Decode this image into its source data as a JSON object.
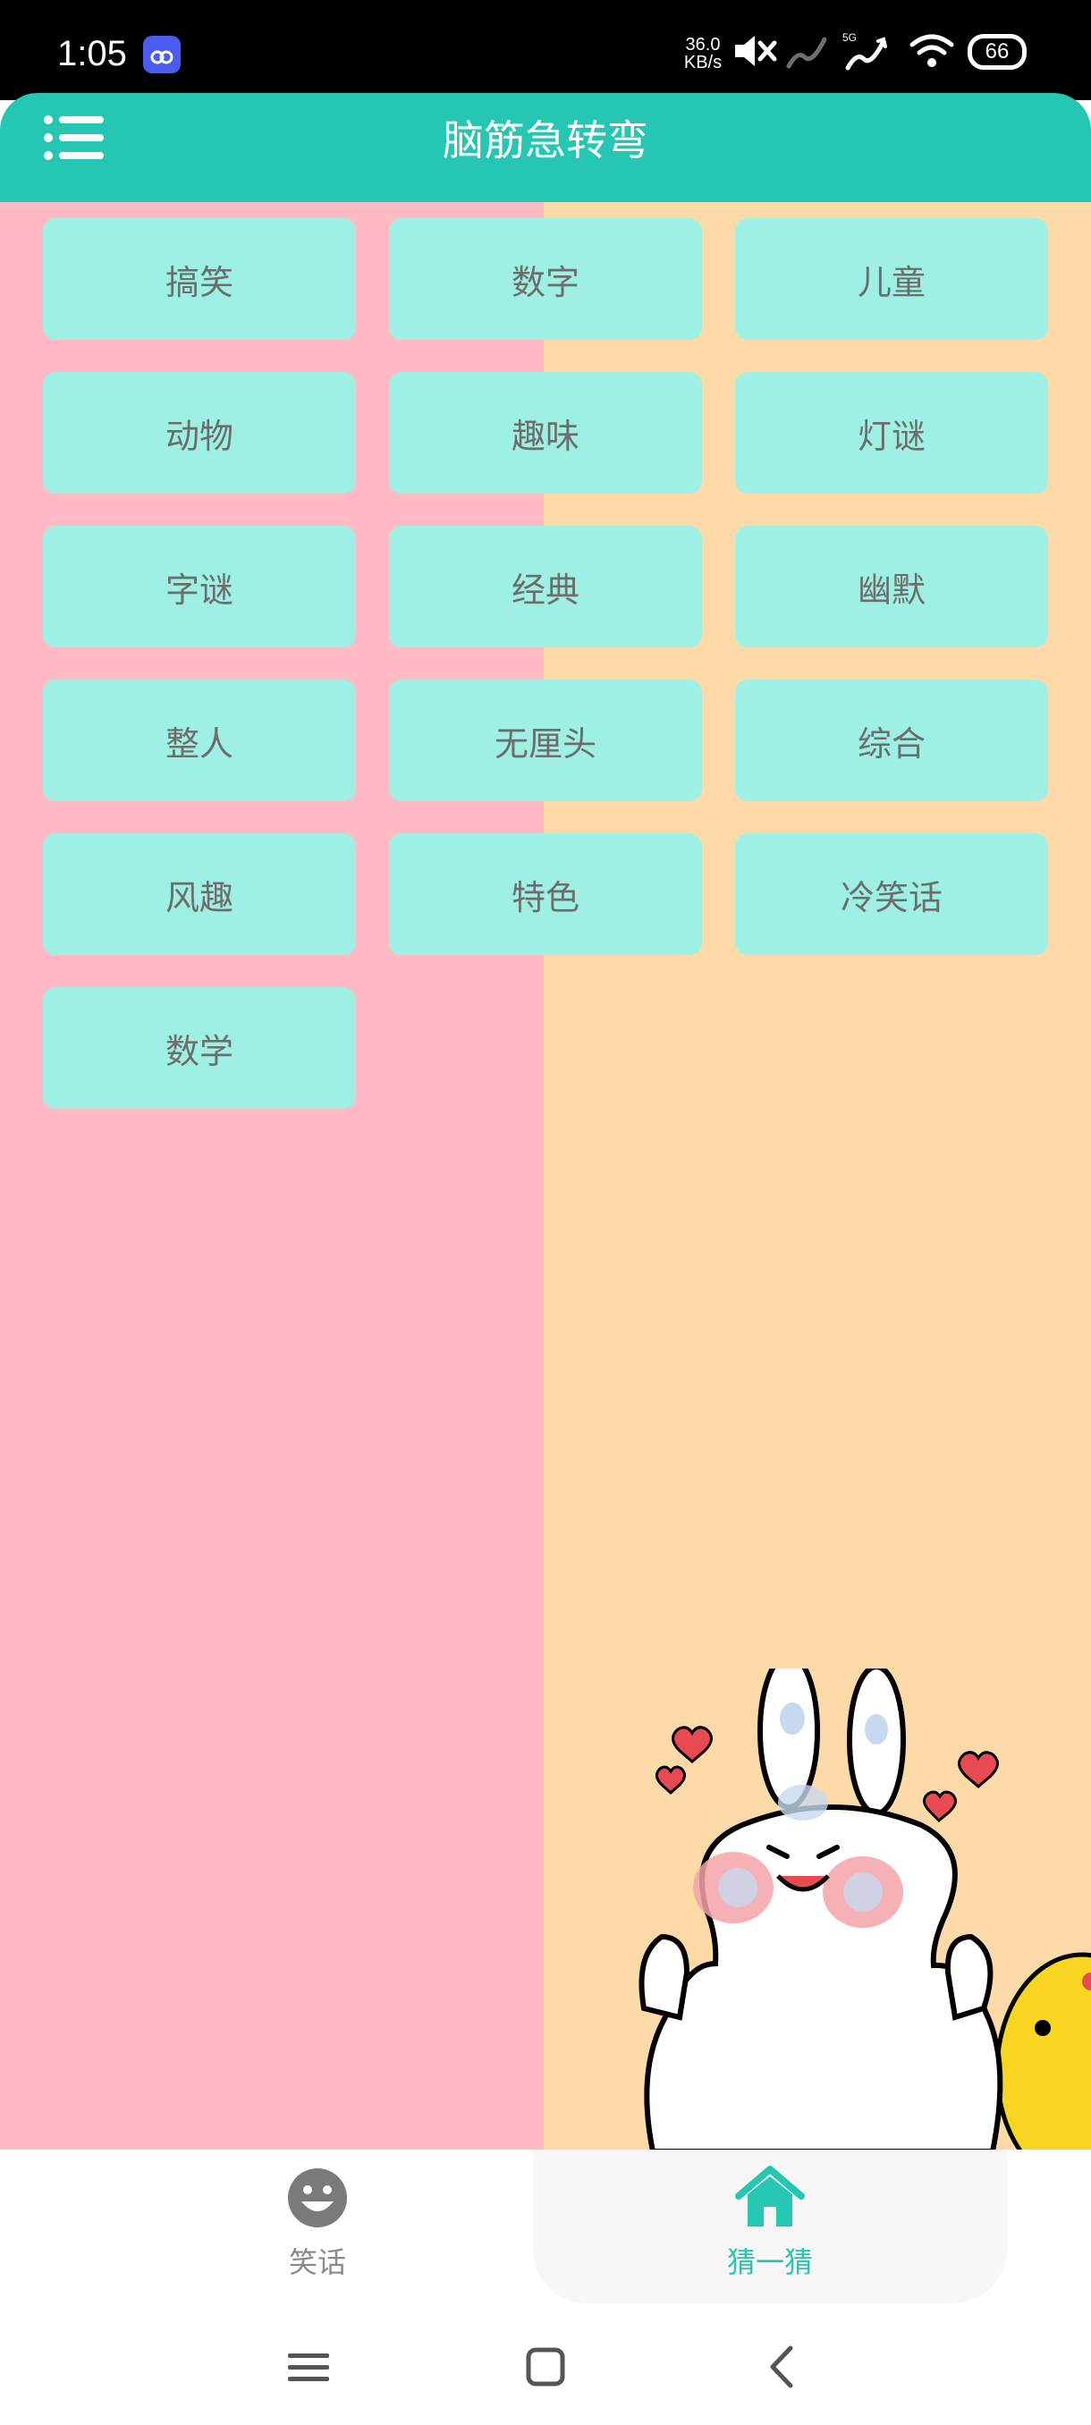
{
  "status_bar": {
    "time": "1:05",
    "net_speed_value": "36.0",
    "net_speed_unit": "KB/s",
    "network_type": "5G",
    "battery": "66",
    "icons": [
      "app-notification-icon",
      "mute-icon",
      "signal-icon",
      "signal-5g-icon",
      "wifi-icon",
      "battery-icon"
    ]
  },
  "header": {
    "title": "脑筋急转弯",
    "menu_icon": "menu-list-icon"
  },
  "categories": [
    "搞笑",
    "数字",
    "儿童",
    "动物",
    "趣味",
    "灯谜",
    "字谜",
    "经典",
    "幽默",
    "整人",
    "无厘头",
    "综合",
    "风趣",
    "特色",
    "冷笑话",
    "数学"
  ],
  "bottom_nav": {
    "jokes_label": "笑话",
    "jokes_icon": "smiley-face-icon",
    "guess_label": "猜一猜",
    "guess_icon": "home-icon",
    "active": "猜一猜"
  },
  "colors": {
    "accent": "#25c7b2",
    "category_button": "#9ff0e4",
    "background_left": "#ffbac3",
    "background_right": "#fddaa8"
  }
}
